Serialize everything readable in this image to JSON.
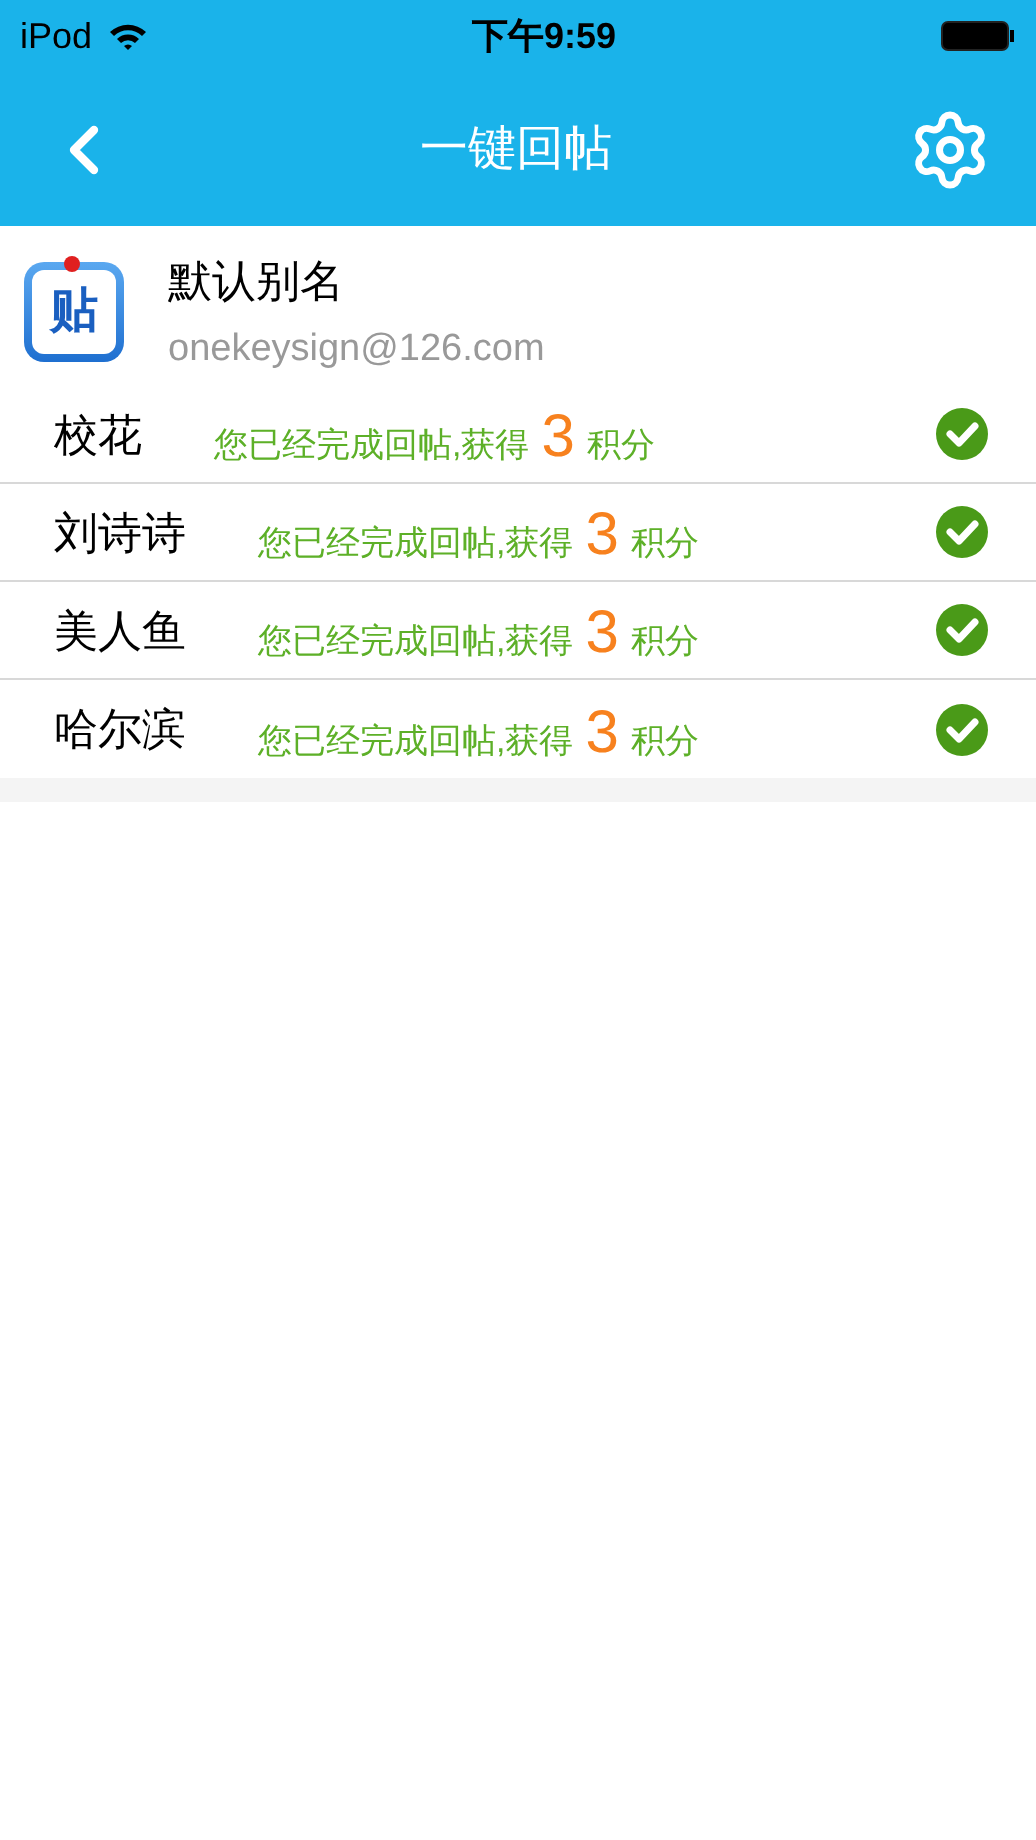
{
  "status_bar": {
    "carrier": "iPod",
    "time": "下午9:59"
  },
  "nav": {
    "title": "一键回帖"
  },
  "account": {
    "icon_glyph": "贴",
    "name": "默认别名",
    "email": "onekeysign@126.com"
  },
  "rows": [
    {
      "name": "校花",
      "message": "您已经完成回帖,获得",
      "points": "3",
      "unit": "积分",
      "done": true
    },
    {
      "name": "刘诗诗",
      "message": "您已经完成回帖,获得",
      "points": "3",
      "unit": "积分",
      "done": true
    },
    {
      "name": "美人鱼",
      "message": "您已经完成回帖,获得",
      "points": "3",
      "unit": "积分",
      "done": true
    },
    {
      "name": "哈尔滨",
      "message": "您已经完成回帖,获得",
      "points": "3",
      "unit": "积分",
      "done": true
    }
  ]
}
